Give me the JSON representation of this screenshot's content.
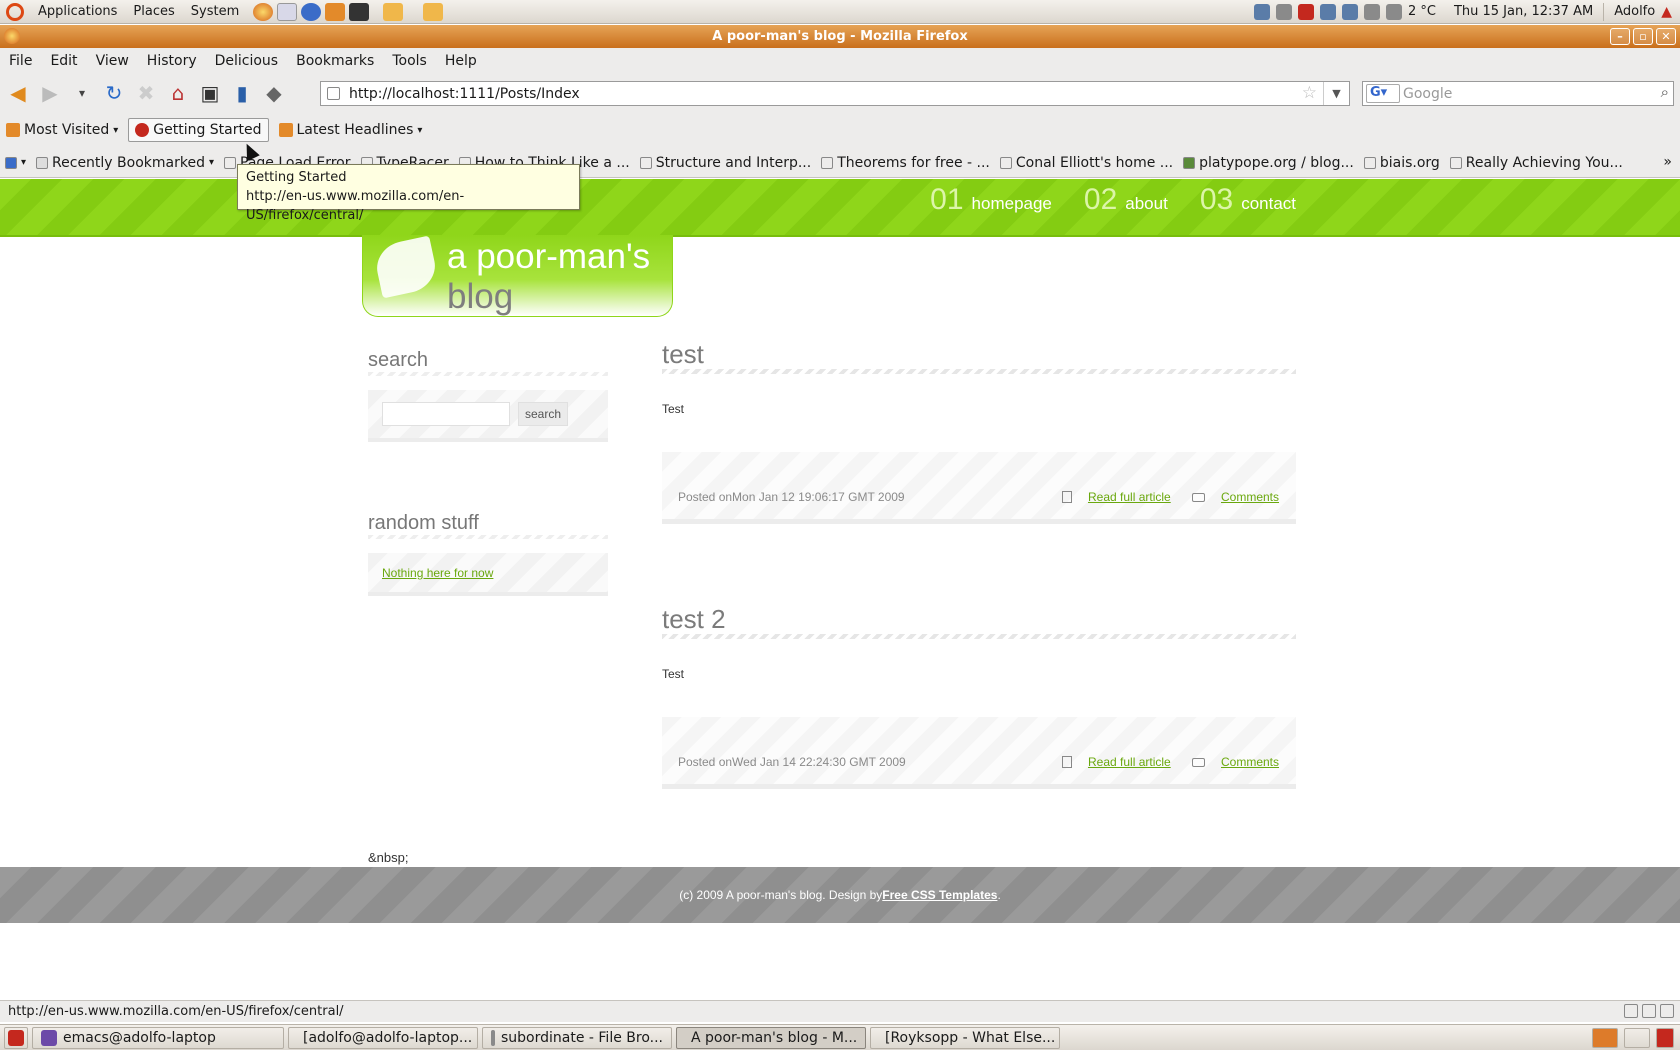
{
  "top_panel": {
    "menus": [
      "Applications",
      "Places",
      "System"
    ],
    "weather": "2 °C",
    "clock": "Thu 15 Jan, 12:37 AM",
    "user": "Adolfo"
  },
  "window": {
    "title": "A poor-man's blog - Mozilla Firefox"
  },
  "menubar": [
    "File",
    "Edit",
    "View",
    "History",
    "Delicious",
    "Bookmarks",
    "Tools",
    "Help"
  ],
  "navbar": {
    "url": "http://localhost:1111/Posts/Index",
    "search_placeholder": "Google"
  },
  "bookmarks_toolbar": {
    "most_visited": "Most Visited",
    "getting_started": "Getting Started",
    "latest_headlines": "Latest Headlines"
  },
  "delicious_toolbar": {
    "recently_bookmarked": "Recently Bookmarked",
    "items": [
      "Page Load Error",
      "TypeRacer",
      "How to Think Like a ...",
      "Structure and Interp...",
      "Theorems for free - ...",
      "Conal Elliott's home ...",
      "platypope.org / blog...",
      "biais.org",
      "Really Achieving You..."
    ]
  },
  "tooltip": {
    "title": "Getting Started",
    "url": "http://en-us.www.mozilla.com/en-US/firefox/central/"
  },
  "site": {
    "nav": [
      {
        "num": "01",
        "label": "homepage"
      },
      {
        "num": "02",
        "label": "about"
      },
      {
        "num": "03",
        "label": "contact"
      }
    ],
    "logo_line1": "a poor-man's",
    "logo_line2": "blog",
    "sidebar": {
      "search_heading": "search",
      "search_button": "search",
      "random_heading": "random stuff",
      "random_link": "Nothing here for now"
    },
    "posts": [
      {
        "title": "test",
        "body": "Test",
        "posted": "Posted onMon Jan 12 19:06:17 GMT 2009",
        "read_more": "Read full article",
        "comments": "Comments"
      },
      {
        "title": "test 2",
        "body": "Test",
        "posted": "Posted onWed Jan 14 22:24:30 GMT 2009",
        "read_more": "Read full article",
        "comments": "Comments"
      }
    ],
    "nbsp": "&nbsp;",
    "footer_text": "(c) 2009 A poor-man's blog. Design by ",
    "footer_link": "Free CSS Templates",
    "footer_end": "."
  },
  "statusbar": {
    "text": "http://en-us.www.mozilla.com/en-US/firefox/central/"
  },
  "taskbar": [
    "emacs@adolfo-laptop",
    "[adolfo@adolfo-laptop...",
    "subordinate - File Bro...",
    "A poor-man's blog - M...",
    "[Royksopp - What Else..."
  ]
}
